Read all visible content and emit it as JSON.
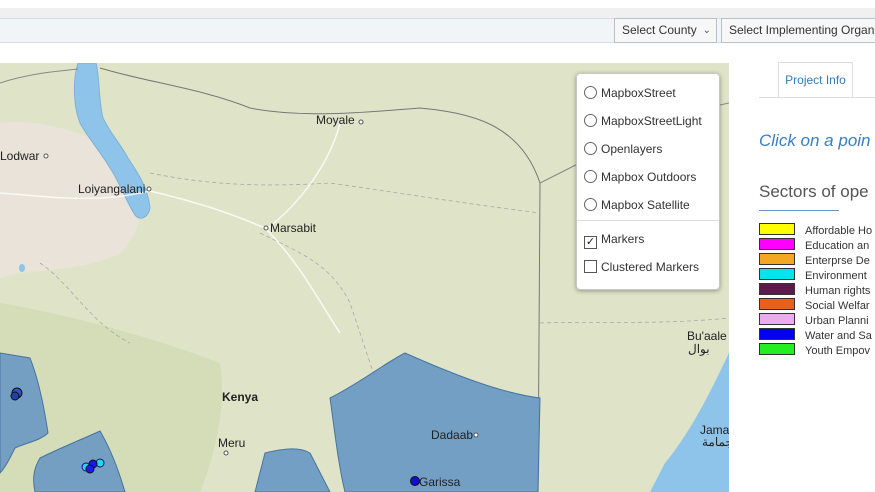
{
  "filters": {
    "county": "Select County",
    "organization": "Select Implementing Organ"
  },
  "map": {
    "labels": {
      "lodwar": "Lodwar",
      "loiyangalani": "Loiyangalani",
      "moyale": "Moyale",
      "marsabit": "Marsabit",
      "kenya": "Kenya",
      "meru": "Meru",
      "dadaab": "Dadaab",
      "garissa": "Garissa",
      "buaale": "Bu'aale",
      "buaale_ar": "بوال",
      "jamame": "Jama",
      "jamame_ar": "جمامة"
    },
    "colors": {
      "land": "#dfe4c8",
      "desert": "#e9e4d8",
      "water": "#8ec3ea",
      "county_fill": "#6f9cc4"
    }
  },
  "layers": {
    "base": [
      "MapboxStreet",
      "MapboxStreetLight",
      "Openlayers",
      "Mapbox Outdoors",
      "Mapbox Satellite"
    ],
    "overlays": [
      {
        "label": "Markers",
        "checked": true
      },
      {
        "label": "Clustered Markers",
        "checked": false
      }
    ]
  },
  "panel": {
    "tab": "Project Info",
    "click_note": "Click on a poin",
    "sectors_title": "Sectors of ope",
    "legend": [
      {
        "label": "Affordable Ho",
        "color": "#ffff00"
      },
      {
        "label": "Education an",
        "color": "#ff00ff"
      },
      {
        "label": "Enterprse De",
        "color": "#f5a623"
      },
      {
        "label": "Environment",
        "color": "#00e5ee"
      },
      {
        "label": "Human rights",
        "color": "#5a1a4a"
      },
      {
        "label": "Social Welfar",
        "color": "#e8601c"
      },
      {
        "label": "Urban Planni",
        "color": "#eeaaee"
      },
      {
        "label": "Water and Sa",
        "color": "#0000ee"
      },
      {
        "label": "Youth Empov",
        "color": "#22ee22"
      }
    ]
  }
}
